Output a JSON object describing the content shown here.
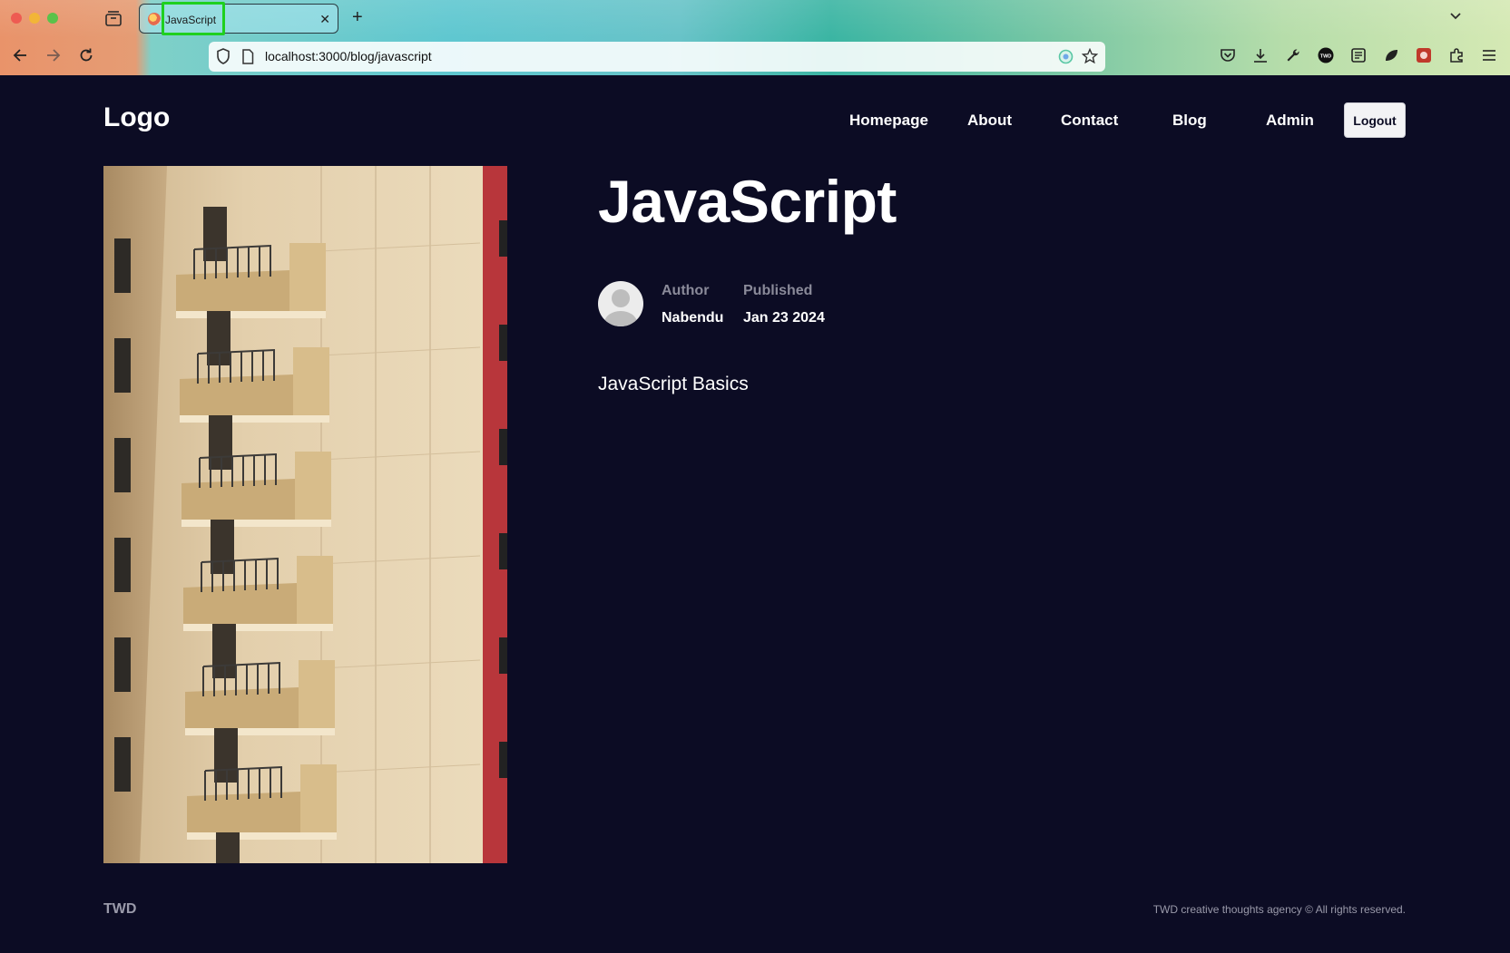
{
  "browser": {
    "tab_title": "JavaScript",
    "url": "localhost:3000/blog/javascript"
  },
  "site": {
    "logo": "Logo",
    "nav": [
      "Homepage",
      "About",
      "Contact",
      "Blog",
      "Admin"
    ],
    "logout_label": "Logout"
  },
  "post": {
    "title": "JavaScript",
    "author_label": "Author",
    "author": "Nabendu",
    "published_label": "Published",
    "published": "Jan 23 2024",
    "body": "JavaScript Basics"
  },
  "footer": {
    "brand": "TWD",
    "copyright": "TWD creative thoughts agency © All rights reserved."
  },
  "colors": {
    "page_bg": "#0c0c24",
    "text": "#ffffff",
    "muted": "#8a8a99",
    "tab_highlight": "#1fd01f"
  }
}
